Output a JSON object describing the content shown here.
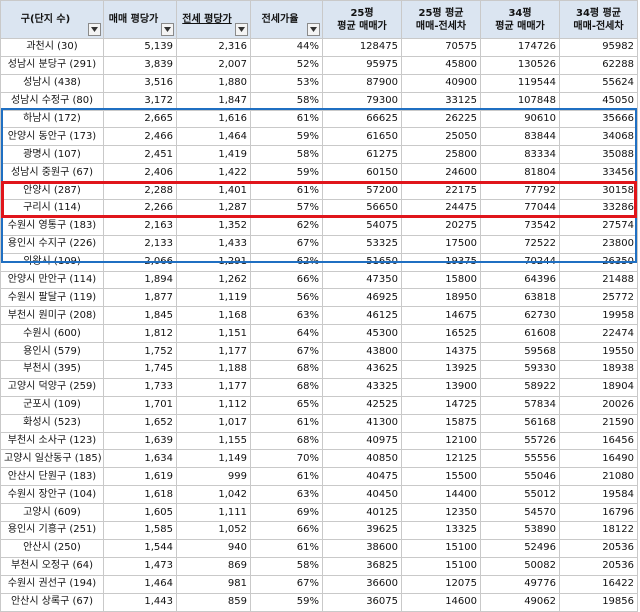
{
  "headers": {
    "gu": "구(단지 수)",
    "sale": "매매 평당가",
    "jeonse": "전세 평당가",
    "ratio": "전세가율",
    "p25_sale": [
      "25평",
      "평균 매매가"
    ],
    "p25_gap": [
      "25평 평균",
      "매매-전세차"
    ],
    "p34_sale": [
      "34평",
      "평균 매매가"
    ],
    "p34_gap": [
      "34평 평균",
      "매매-전세차"
    ]
  },
  "rows": [
    [
      "과천시 (30)",
      "5,139",
      "2,316",
      "44%",
      "128475",
      "70575",
      "174726",
      "95982"
    ],
    [
      "성남시 분당구 (291)",
      "3,839",
      "2,007",
      "52%",
      "95975",
      "45800",
      "130526",
      "62288"
    ],
    [
      "성남시 (438)",
      "3,516",
      "1,880",
      "53%",
      "87900",
      "40900",
      "119544",
      "55624"
    ],
    [
      "성남시 수정구 (80)",
      "3,172",
      "1,847",
      "58%",
      "79300",
      "33125",
      "107848",
      "45050"
    ],
    [
      "하남시 (172)",
      "2,665",
      "1,616",
      "61%",
      "66625",
      "26225",
      "90610",
      "35666"
    ],
    [
      "안양시 동안구 (173)",
      "2,466",
      "1,464",
      "59%",
      "61650",
      "25050",
      "83844",
      "34068"
    ],
    [
      "광명시 (107)",
      "2,451",
      "1,419",
      "58%",
      "61275",
      "25800",
      "83334",
      "35088"
    ],
    [
      "성남시 중원구 (67)",
      "2,406",
      "1,422",
      "59%",
      "60150",
      "24600",
      "81804",
      "33456"
    ],
    [
      "안양시 (287)",
      "2,288",
      "1,401",
      "61%",
      "57200",
      "22175",
      "77792",
      "30158"
    ],
    [
      "구리시 (114)",
      "2,266",
      "1,287",
      "57%",
      "56650",
      "24475",
      "77044",
      "33286"
    ],
    [
      "수원시 영통구 (183)",
      "2,163",
      "1,352",
      "62%",
      "54075",
      "20275",
      "73542",
      "27574"
    ],
    [
      "용인시 수지구 (226)",
      "2,133",
      "1,433",
      "67%",
      "53325",
      "17500",
      "72522",
      "23800"
    ],
    [
      "의왕시 (109)",
      "2,066",
      "1,291",
      "62%",
      "51650",
      "19375",
      "70244",
      "26350"
    ],
    [
      "안양시 만안구 (114)",
      "1,894",
      "1,262",
      "66%",
      "47350",
      "15800",
      "64396",
      "21488"
    ],
    [
      "수원시 팔달구 (119)",
      "1,877",
      "1,119",
      "56%",
      "46925",
      "18950",
      "63818",
      "25772"
    ],
    [
      "부천시 원미구 (208)",
      "1,845",
      "1,168",
      "63%",
      "46125",
      "14675",
      "62730",
      "19958"
    ],
    [
      "수원시 (600)",
      "1,812",
      "1,151",
      "64%",
      "45300",
      "16525",
      "61608",
      "22474"
    ],
    [
      "용인시 (579)",
      "1,752",
      "1,177",
      "67%",
      "43800",
      "14375",
      "59568",
      "19550"
    ],
    [
      "부천시 (395)",
      "1,745",
      "1,188",
      "68%",
      "43625",
      "13925",
      "59330",
      "18938"
    ],
    [
      "고양시 덕양구 (259)",
      "1,733",
      "1,177",
      "68%",
      "43325",
      "13900",
      "58922",
      "18904"
    ],
    [
      "군포시 (109)",
      "1,701",
      "1,112",
      "65%",
      "42525",
      "14725",
      "57834",
      "20026"
    ],
    [
      "화성시 (523)",
      "1,652",
      "1,017",
      "61%",
      "41300",
      "15875",
      "56168",
      "21590"
    ],
    [
      "부천시 소사구 (123)",
      "1,639",
      "1,155",
      "68%",
      "40975",
      "12100",
      "55726",
      "16456"
    ],
    [
      "고양시 일산동구 (185)",
      "1,634",
      "1,149",
      "70%",
      "40850",
      "12125",
      "55556",
      "16490"
    ],
    [
      "안산시 단원구 (183)",
      "1,619",
      "999",
      "61%",
      "40475",
      "15500",
      "55046",
      "21080"
    ],
    [
      "수원시 장안구 (104)",
      "1,618",
      "1,042",
      "63%",
      "40450",
      "14400",
      "55012",
      "19584"
    ],
    [
      "고양시 (609)",
      "1,605",
      "1,111",
      "69%",
      "40125",
      "12350",
      "54570",
      "16796"
    ],
    [
      "용인시 기흥구 (251)",
      "1,585",
      "1,052",
      "66%",
      "39625",
      "13325",
      "53890",
      "18122"
    ],
    [
      "안산시 (250)",
      "1,544",
      "940",
      "61%",
      "38600",
      "15100",
      "52496",
      "20536"
    ],
    [
      "부천시 오정구 (64)",
      "1,473",
      "869",
      "58%",
      "36825",
      "15100",
      "50082",
      "20536"
    ],
    [
      "수원시 권선구 (194)",
      "1,464",
      "981",
      "67%",
      "36600",
      "12075",
      "49776",
      "16422"
    ],
    [
      "안산시 상록구 (67)",
      "1,443",
      "859",
      "59%",
      "36075",
      "14600",
      "49062",
      "19856"
    ]
  ],
  "colors": {
    "header_bg": "#dbe5f1",
    "blue_box": "#1f6fc2",
    "red_box": "#e0151b"
  },
  "icons": {
    "filter": "filter-dropdown-icon"
  }
}
